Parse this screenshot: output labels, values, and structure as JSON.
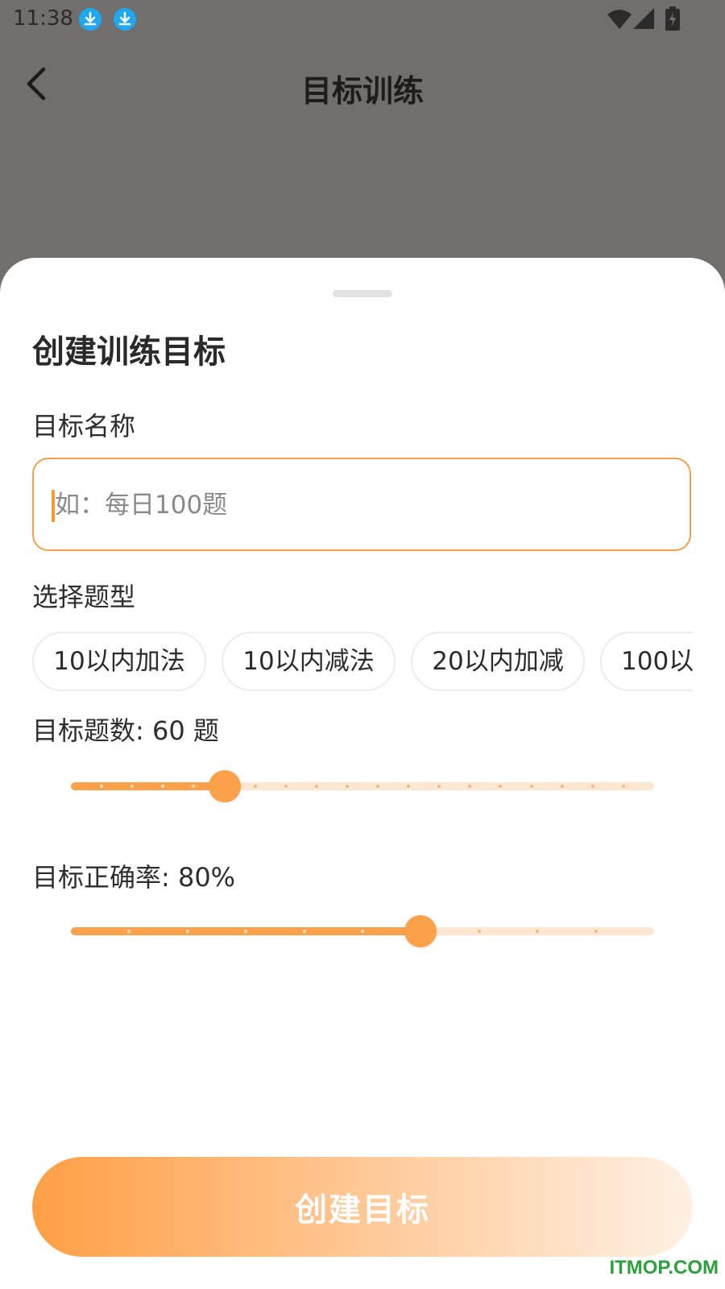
{
  "status_bar": {
    "time": "11:38"
  },
  "header": {
    "title": "目标训练"
  },
  "sheet": {
    "title": "创建训练目标",
    "name_field": {
      "label": "目标名称",
      "placeholder": "如：每日100题",
      "value": ""
    },
    "type_field": {
      "label": "选择题型",
      "chips": [
        "10以内加法",
        "10以内减法",
        "20以内加减",
        "100以"
      ]
    },
    "count_slider": {
      "label": "目标题数: 60 题",
      "value": 60,
      "min": 10,
      "max": 200,
      "step": 10
    },
    "accuracy_slider": {
      "label": "目标正确率: 80%",
      "value": 80,
      "min": 50,
      "max": 100,
      "step": 5
    },
    "create_button_label": "创建目标"
  },
  "watermark": "ITMOP.COM",
  "colors": {
    "accent": "#fba14a",
    "track": "#fde7d3",
    "overlay": "#706f6d"
  }
}
